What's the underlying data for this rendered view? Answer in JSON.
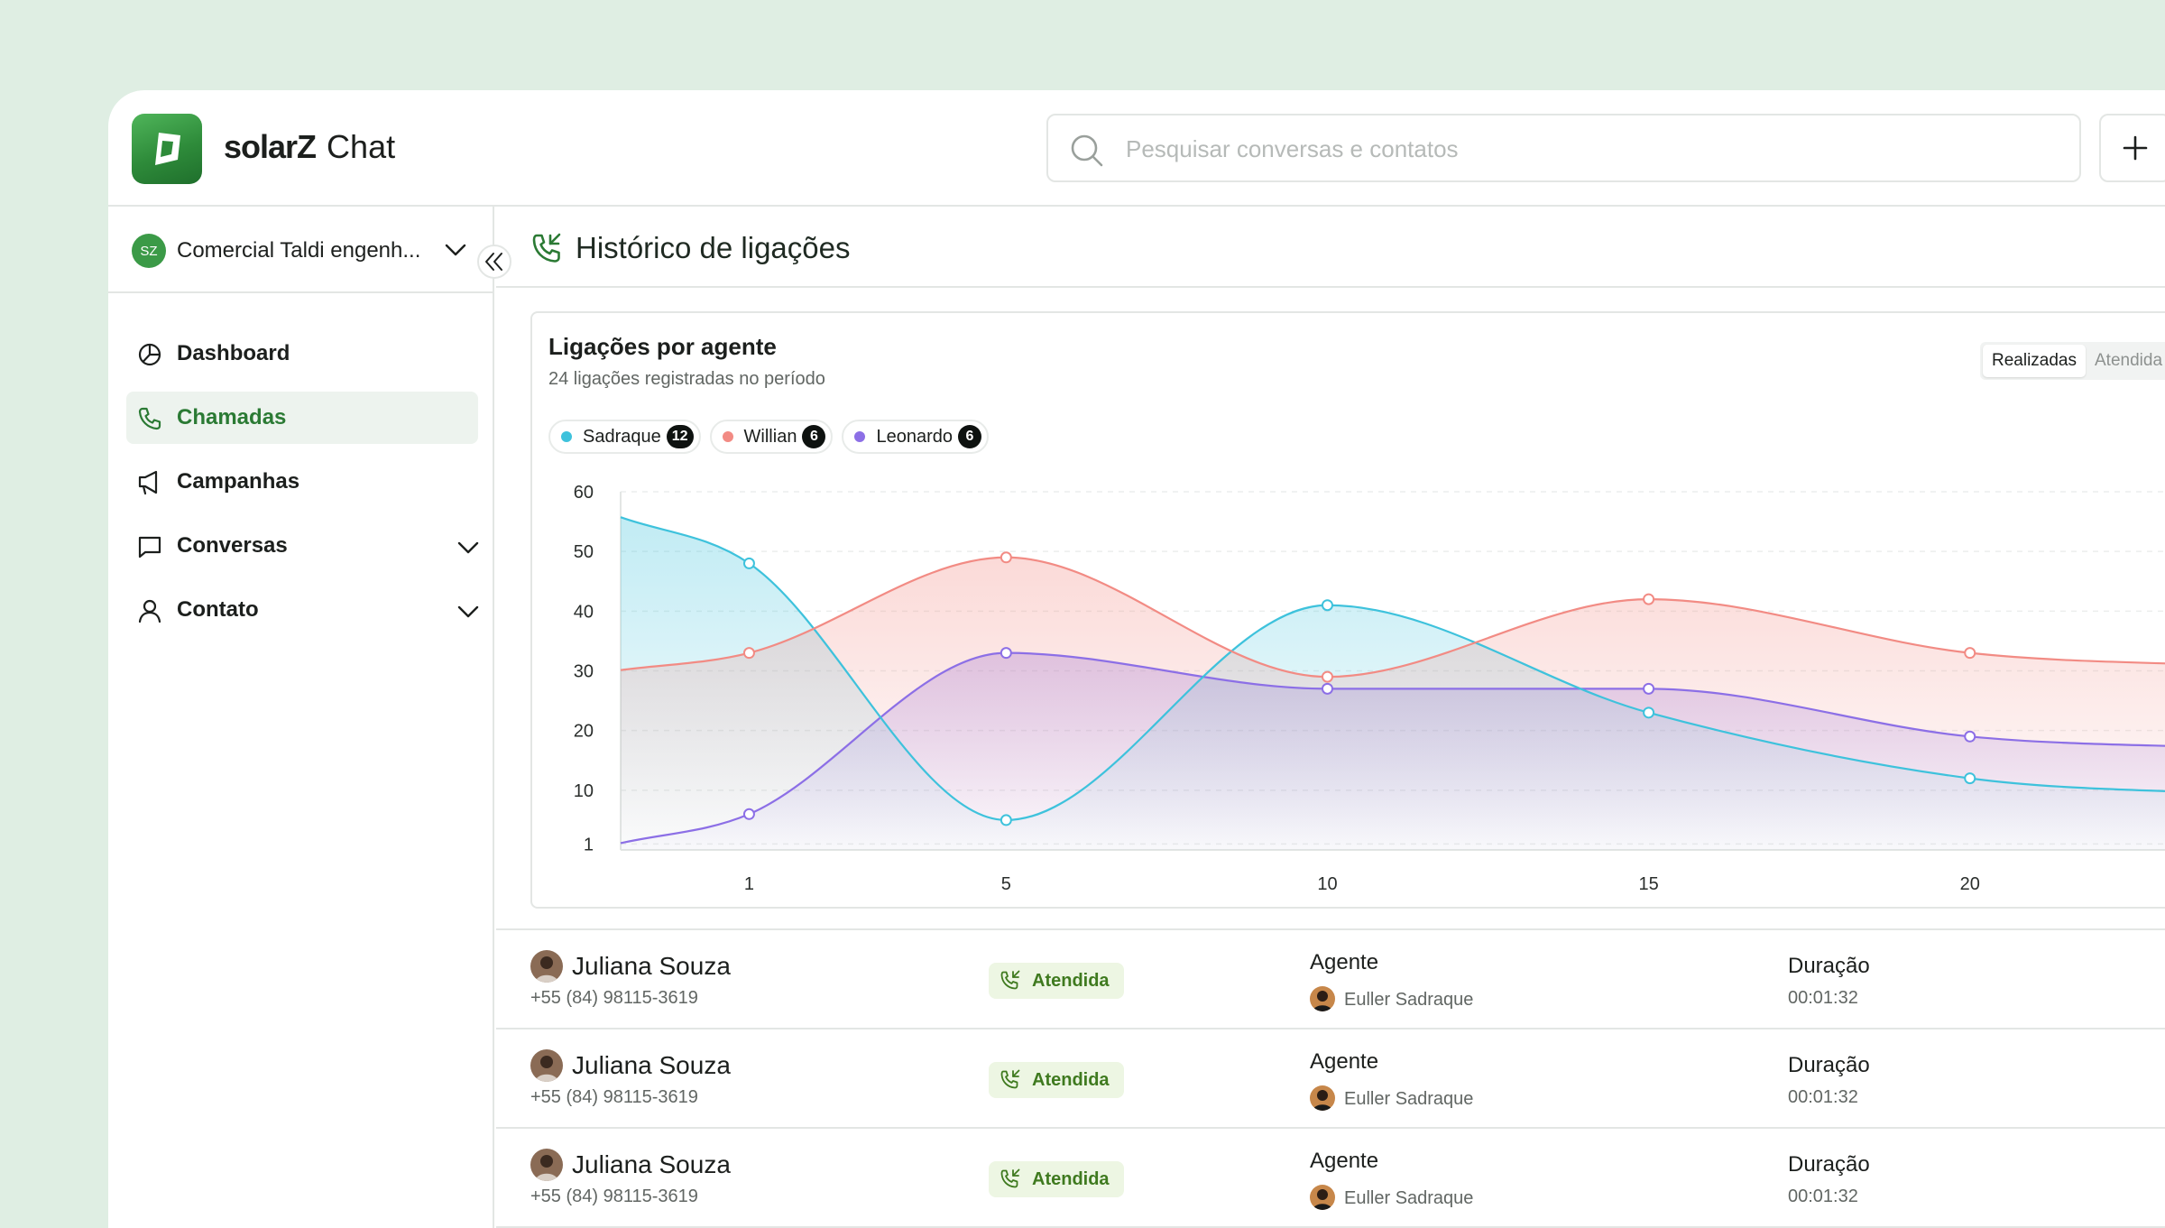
{
  "app": {
    "brand_name": "solarZ",
    "brand_suffix": "Chat",
    "accent": "#2e8b3a"
  },
  "search": {
    "placeholder": "Pesquisar conversas e contatos"
  },
  "account": {
    "initials": "SZ",
    "name": "Comercial Taldi engenh..."
  },
  "nav": [
    {
      "label": "Dashboard",
      "icon": "pie-chart-icon",
      "active": false,
      "expandable": false
    },
    {
      "label": "Chamadas",
      "icon": "phone-icon",
      "active": true,
      "expandable": false
    },
    {
      "label": "Campanhas",
      "icon": "megaphone-icon",
      "active": false,
      "expandable": false
    },
    {
      "label": "Conversas",
      "icon": "chat-bubble-icon",
      "active": false,
      "expandable": true
    },
    {
      "label": "Contato",
      "icon": "user-icon",
      "active": false,
      "expandable": true
    }
  ],
  "page": {
    "title": "Histórico de ligações"
  },
  "chart_card": {
    "title": "Ligações por agente",
    "subtitle": "24 ligações registradas no período",
    "toggle": [
      "Realizadas",
      "Atendida"
    ],
    "toggle_active": "Realizadas"
  },
  "chart_data": {
    "type": "area",
    "title": "Ligações por agente",
    "subtitle": "24 ligações registradas no período",
    "x_ticks": [
      1,
      5,
      10,
      15,
      20
    ],
    "y_ticks": [
      1,
      10,
      20,
      30,
      40,
      50,
      60
    ],
    "ylim": [
      0,
      60
    ],
    "xlim": [
      -1,
      24.3
    ],
    "grid": true,
    "legend_placement": "top-left",
    "x": [
      1,
      5,
      10,
      15,
      20
    ],
    "series": [
      {
        "name": "Sadraque",
        "count": 12,
        "color": "#3ec2dc",
        "values": [
          48,
          5,
          41,
          23,
          12
        ]
      },
      {
        "name": "Willian",
        "count": 6,
        "color": "#f28b84",
        "values": [
          33,
          49,
          29,
          42,
          33
        ]
      },
      {
        "name": "Leonardo",
        "count": 6,
        "color": "#8c6fe6",
        "values": [
          6,
          33,
          27,
          27,
          19
        ]
      }
    ]
  },
  "calls": [
    {
      "name": "Juliana Souza",
      "phone": "+55 (84) 98115-3619",
      "status": "Atendida",
      "agent_label": "Agente",
      "agent": "Euller Sadraque",
      "duration_label": "Duração",
      "duration": "00:01:32"
    },
    {
      "name": "Juliana Souza",
      "phone": "+55 (84) 98115-3619",
      "status": "Atendida",
      "agent_label": "Agente",
      "agent": "Euller Sadraque",
      "duration_label": "Duração",
      "duration": "00:01:32"
    },
    {
      "name": "Juliana Souza",
      "phone": "+55 (84) 98115-3619",
      "status": "Atendida",
      "agent_label": "Agente",
      "agent": "Euller Sadraque",
      "duration_label": "Duração",
      "duration": "00:01:32"
    }
  ]
}
